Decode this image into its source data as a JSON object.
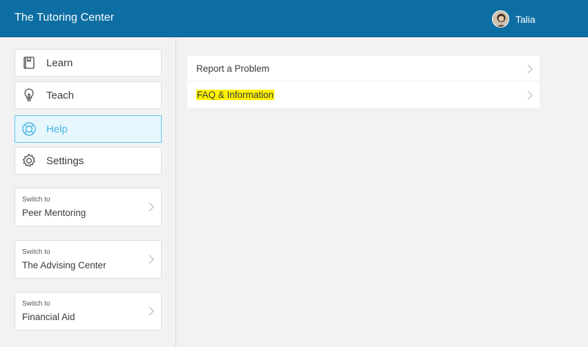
{
  "header": {
    "title": "The Tutoring Center",
    "user_name": "Talia"
  },
  "nav": [
    {
      "label": "Learn",
      "icon": "book-icon"
    },
    {
      "label": "Teach",
      "icon": "lightbulb-icon"
    },
    {
      "label": "Help",
      "icon": "lifebuoy-icon",
      "active": true
    },
    {
      "label": "Settings",
      "icon": "gear-icon"
    }
  ],
  "switch_cards": [
    {
      "prefix": "Switch to",
      "name": "Peer Mentoring"
    },
    {
      "prefix": "Switch to",
      "name": "The Advising Center"
    },
    {
      "prefix": "Switch to",
      "name": "Financial Aid"
    }
  ],
  "help_menu": [
    {
      "label": "Report a Problem"
    },
    {
      "label": "FAQ & Information",
      "highlighted": true
    }
  ],
  "colors": {
    "header_bg": "#0d6ea3",
    "active_accent": "#45b6e4",
    "highlight": "#fff200"
  }
}
